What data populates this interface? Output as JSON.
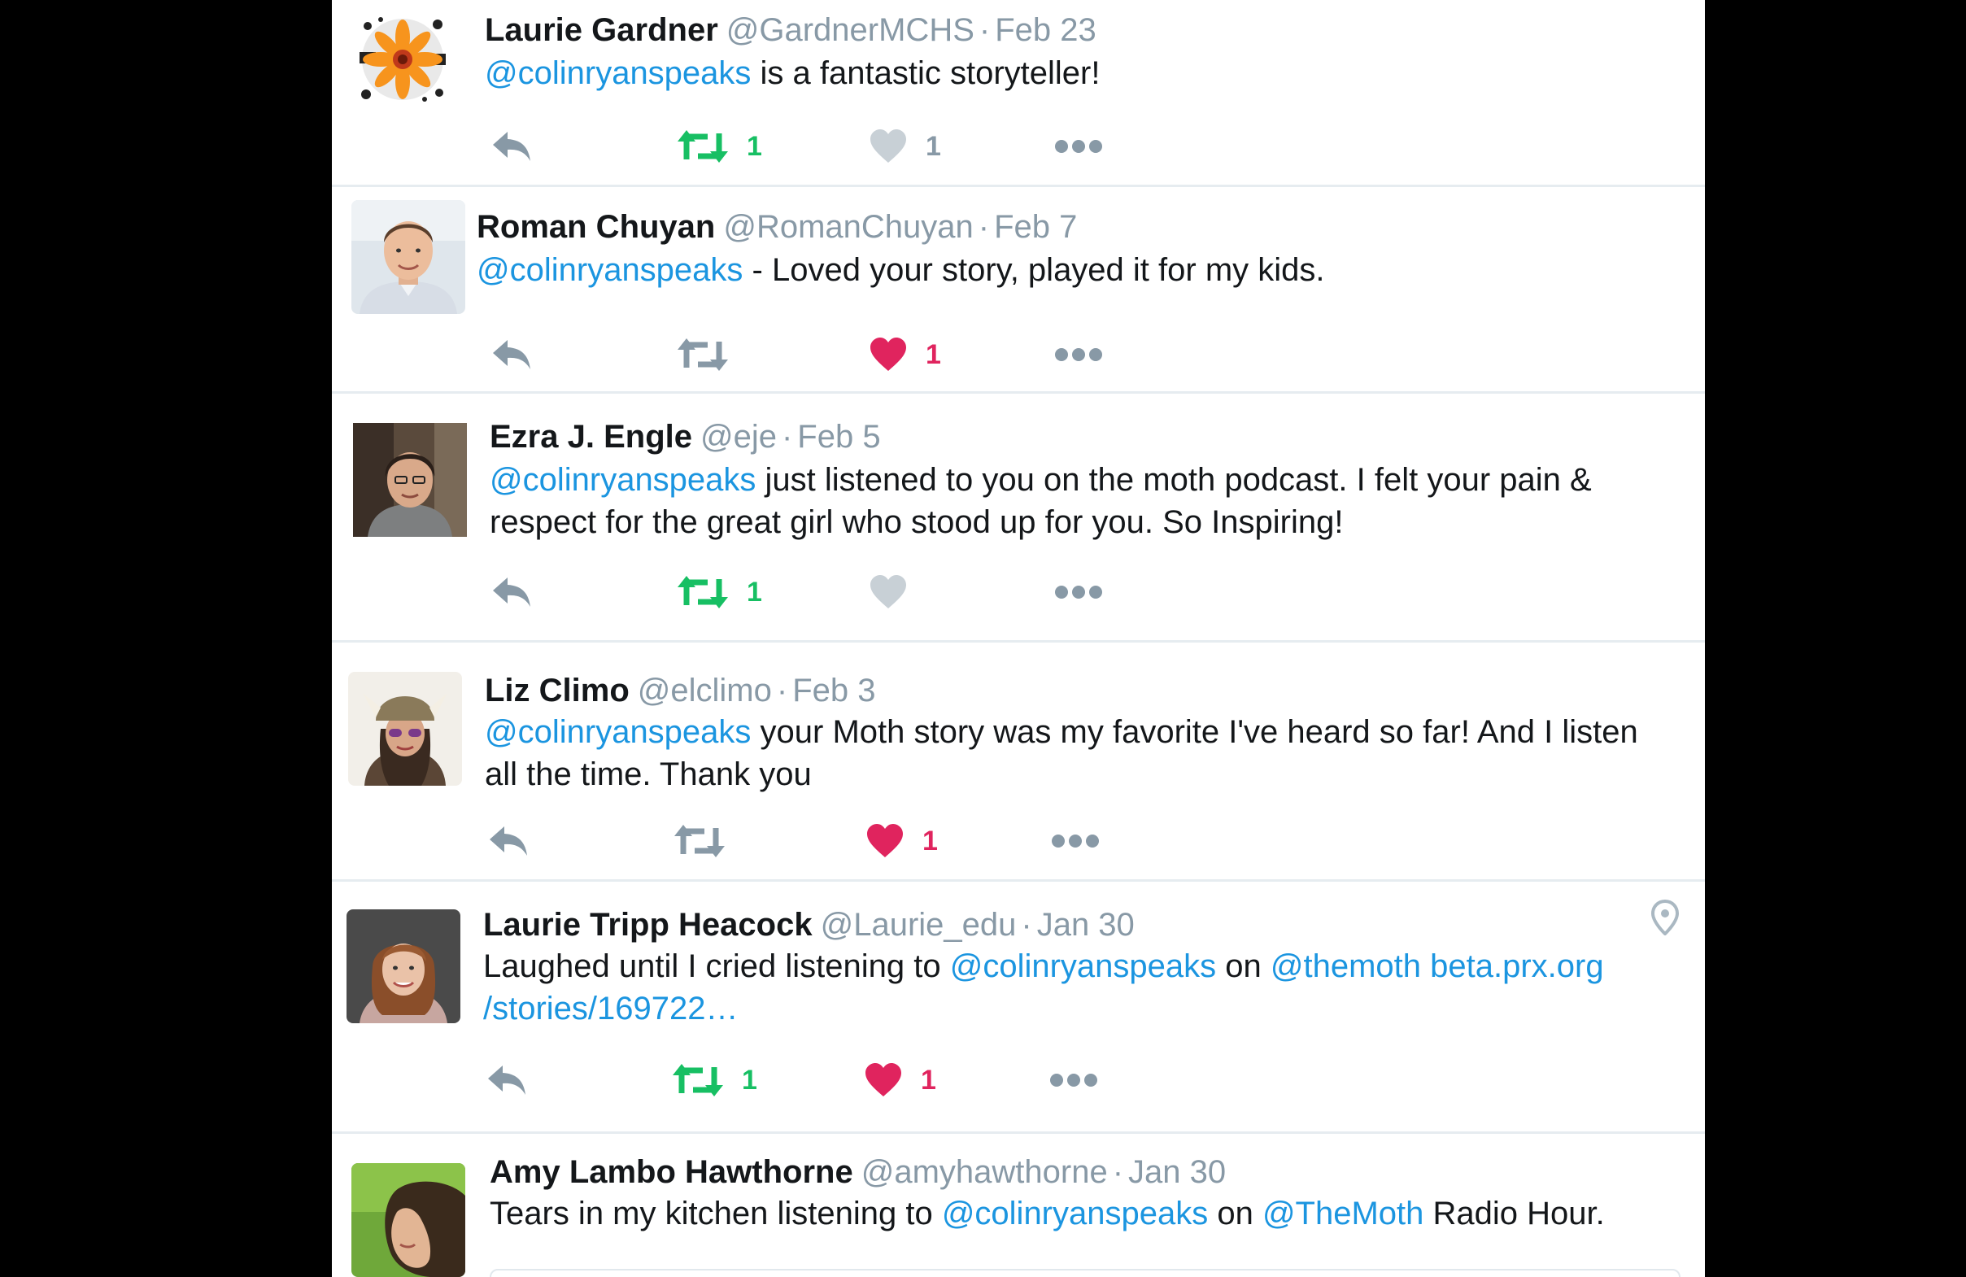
{
  "colors": {
    "mention": "#1b95e0",
    "retweet_active": "#17bf63",
    "like_active": "#e0245e",
    "icon_inactive": "#8899a6"
  },
  "tweets": [
    {
      "name": "Laurie Gardner",
      "handle": "@GardnerMCHS",
      "date": "Feb 23",
      "mention": "@colinryanspeaks",
      "text": " is a fantastic storyteller!",
      "retweet_count": "1",
      "like_count": "1",
      "retweeted": true,
      "liked": false,
      "icons": [
        "reply-icon",
        "retweet-icon",
        "heart-icon",
        "more-icon"
      ]
    },
    {
      "name": "Roman Chuyan",
      "handle": "@RomanChuyan",
      "date": "Feb 7",
      "mention": "@colinryanspeaks",
      "text": " - Loved your story, played it for my kids.",
      "retweet_count": "",
      "like_count": "1",
      "retweeted": false,
      "liked": true
    },
    {
      "name": "Ezra J. Engle",
      "handle": "@eje",
      "date": "Feb 5",
      "mention": "@colinryanspeaks",
      "text": " just listened to you on the moth podcast. I felt your pain & respect for the great girl who stood up for you. So Inspiring!",
      "retweet_count": "1",
      "like_count": "",
      "retweeted": true,
      "liked": false
    },
    {
      "name": "Liz Climo",
      "handle": "@elclimo",
      "date": "Feb 3",
      "mention": "@colinryanspeaks",
      "text": " your Moth story was my favorite I've heard so far! And I listen all the time. Thank you",
      "retweet_count": "",
      "like_count": "1",
      "retweeted": false,
      "liked": true
    },
    {
      "name": "Laurie Tripp Heacock",
      "handle": "@Laurie_edu",
      "date": "Jan 30",
      "text_before": "Laughed until I cried listening to ",
      "mention": "@colinryanspeaks",
      "text_middle": " on ",
      "mention2": "@themoth",
      "link": "beta.prx.org",
      "link2": "/stories/169722…",
      "retweet_count": "1",
      "like_count": "1",
      "retweeted": true,
      "liked": true,
      "location_icon": "map-pin-icon"
    },
    {
      "name": "Amy Lambo Hawthorne",
      "handle": "@amyhawthorne",
      "date": "Jan 30",
      "text_before": "Tears in my kitchen listening to ",
      "mention": "@colinryanspeaks",
      "text_middle": " on ",
      "mention2": "@TheMoth",
      "text_after": " Radio Hour."
    }
  ]
}
